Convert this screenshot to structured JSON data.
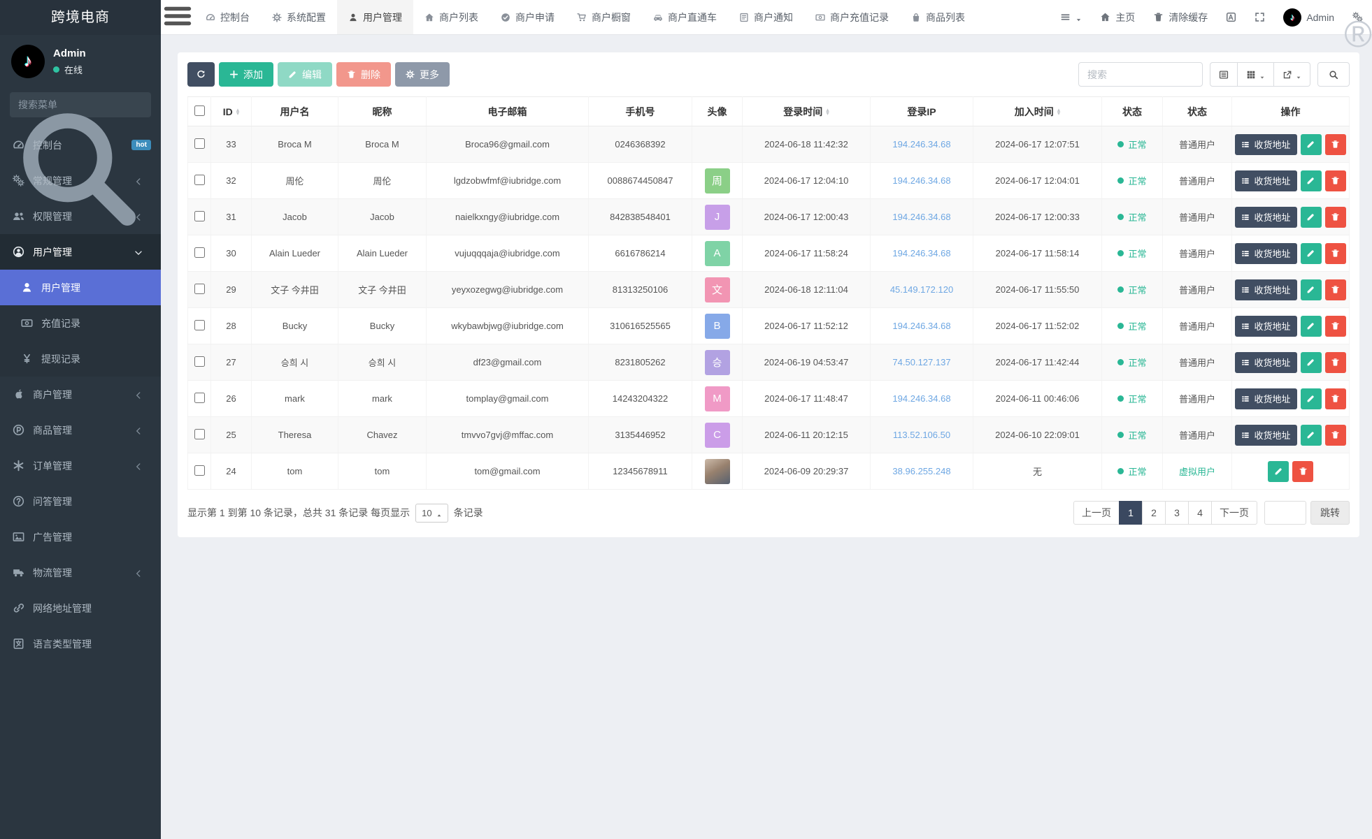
{
  "app": {
    "brand": "跨境电商",
    "user": "Admin",
    "status_label": "在线",
    "menu_search_placeholder": "搜索菜单",
    "watermark": "®"
  },
  "colors": {
    "sidebar_bg": "#2b3640",
    "active_menu_blue": "#5a6fd6",
    "accent_green": "#2ab795",
    "accent_red": "#ee5242",
    "dark_button": "#414e62",
    "link_blue": "#6ea7e3",
    "badge_hot_bg": "#3c8dbc"
  },
  "sidebar": {
    "items": [
      {
        "label": "控制台",
        "icon": "gauge",
        "badge": "hot"
      },
      {
        "label": "常规管理",
        "icon": "gears",
        "arrow": "left"
      },
      {
        "label": "权限管理",
        "icon": "users",
        "arrow": "left"
      },
      {
        "label": "用户管理",
        "icon": "user-circle",
        "arrow": "down",
        "open": true,
        "children": [
          {
            "label": "用户管理",
            "icon": "user",
            "active": true
          },
          {
            "label": "充值记录",
            "icon": "money"
          },
          {
            "label": "提现记录",
            "icon": "yen"
          }
        ]
      },
      {
        "label": "商户管理",
        "icon": "apple",
        "arrow": "left"
      },
      {
        "label": "商品管理",
        "icon": "product",
        "arrow": "left"
      },
      {
        "label": "订单管理",
        "icon": "asterisk",
        "arrow": "left"
      },
      {
        "label": "问答管理",
        "icon": "question"
      },
      {
        "label": "广告管理",
        "icon": "image"
      },
      {
        "label": "物流管理",
        "icon": "truck",
        "arrow": "left"
      },
      {
        "label": "网络地址管理",
        "icon": "link"
      },
      {
        "label": "语言类型管理",
        "icon": "language"
      }
    ]
  },
  "navbar": {
    "tabs": [
      {
        "label": "控制台",
        "icon": "gauge"
      },
      {
        "label": "系统配置",
        "icon": "gear"
      },
      {
        "label": "用户管理",
        "icon": "user",
        "active": true
      },
      {
        "label": "商户列表",
        "icon": "home"
      },
      {
        "label": "商户申请",
        "icon": "check-circle"
      },
      {
        "label": "商户橱窗",
        "icon": "cart"
      },
      {
        "label": "商户直通车",
        "icon": "car"
      },
      {
        "label": "商户通知",
        "icon": "notice"
      },
      {
        "label": "商户充值记录",
        "icon": "money"
      },
      {
        "label": "商品列表",
        "icon": "bag"
      }
    ],
    "home_label": "主页",
    "clear_cache_label": "清除缓存",
    "admin_label": "Admin"
  },
  "toolbar": {
    "add_label": "添加",
    "edit_label": "编辑",
    "delete_label": "删除",
    "more_label": "更多",
    "search_placeholder": "搜索"
  },
  "table": {
    "address_label": "收货地址",
    "columns": [
      {
        "label": "ID",
        "sortable": true
      },
      {
        "label": "用户名"
      },
      {
        "label": "昵称"
      },
      {
        "label": "电子邮箱"
      },
      {
        "label": "手机号"
      },
      {
        "label": "头像"
      },
      {
        "label": "登录时间",
        "sortable": true
      },
      {
        "label": "登录IP"
      },
      {
        "label": "加入时间",
        "sortable": true
      },
      {
        "label": "状态"
      },
      {
        "label": "状态"
      },
      {
        "label": "操作"
      }
    ],
    "status_normal": "正常",
    "rows": [
      {
        "id": "33",
        "username": "Broca M",
        "nickname": "Broca M",
        "email": "Broca96@gmail.com",
        "phone": "0246368392",
        "avatar": {
          "type": "none"
        },
        "login_time": "2024-06-18 11:42:32",
        "login_ip": "194.246.34.68",
        "join_time": "2024-06-17 12:07:51",
        "status": "正常",
        "user_type": "普通用户",
        "virtual": false,
        "has_address": true
      },
      {
        "id": "32",
        "username": "周伦",
        "nickname": "周伦",
        "email": "lgdzobwfmf@iubridge.com",
        "phone": "0088674450847",
        "avatar": {
          "type": "letter",
          "text": "周",
          "color": "#8bcf87"
        },
        "login_time": "2024-06-17 12:04:10",
        "login_ip": "194.246.34.68",
        "join_time": "2024-06-17 12:04:01",
        "status": "正常",
        "user_type": "普通用户",
        "virtual": false,
        "has_address": true
      },
      {
        "id": "31",
        "username": "Jacob",
        "nickname": "Jacob",
        "email": "naielkxngy@iubridge.com",
        "phone": "842838548401",
        "avatar": {
          "type": "letter",
          "text": "J",
          "color": "#c79fe8"
        },
        "login_time": "2024-06-17 12:00:43",
        "login_ip": "194.246.34.68",
        "join_time": "2024-06-17 12:00:33",
        "status": "正常",
        "user_type": "普通用户",
        "virtual": false,
        "has_address": true
      },
      {
        "id": "30",
        "username": "Alain Lueder",
        "nickname": "Alain Lueder",
        "email": "vujuqqqaja@iubridge.com",
        "phone": "6616786214",
        "avatar": {
          "type": "letter",
          "text": "A",
          "color": "#7fd3a6"
        },
        "login_time": "2024-06-17 11:58:24",
        "login_ip": "194.246.34.68",
        "join_time": "2024-06-17 11:58:14",
        "status": "正常",
        "user_type": "普通用户",
        "virtual": false,
        "has_address": true
      },
      {
        "id": "29",
        "username": "文子 今井田",
        "nickname": "文子 今井田",
        "email": "yeyxozegwg@iubridge.com",
        "phone": "81313250106",
        "avatar": {
          "type": "letter",
          "text": "文",
          "color": "#f295b3"
        },
        "login_time": "2024-06-18 12:11:04",
        "login_ip": "45.149.172.120",
        "join_time": "2024-06-17 11:55:50",
        "status": "正常",
        "user_type": "普通用户",
        "virtual": false,
        "has_address": true
      },
      {
        "id": "28",
        "username": "Bucky",
        "nickname": "Bucky",
        "email": "wkybawbjwg@iubridge.com",
        "phone": "310616525565",
        "avatar": {
          "type": "letter",
          "text": "B",
          "color": "#86a9e8"
        },
        "login_time": "2024-06-17 11:52:12",
        "login_ip": "194.246.34.68",
        "join_time": "2024-06-17 11:52:02",
        "status": "正常",
        "user_type": "普通用户",
        "virtual": false,
        "has_address": true
      },
      {
        "id": "27",
        "username": "승희 시",
        "nickname": "승희 시",
        "email": "df23@gmail.com",
        "phone": "8231805262",
        "avatar": {
          "type": "letter",
          "text": "승",
          "color": "#b2a2e2"
        },
        "login_time": "2024-06-19 04:53:47",
        "login_ip": "74.50.127.137",
        "join_time": "2024-06-17 11:42:44",
        "status": "正常",
        "user_type": "普通用户",
        "virtual": false,
        "has_address": true
      },
      {
        "id": "26",
        "username": "mark",
        "nickname": "mark",
        "email": "tomplay@gmail.com",
        "phone": "14243204322",
        "avatar": {
          "type": "letter",
          "text": "M",
          "color": "#f09ac6"
        },
        "login_time": "2024-06-17 11:48:47",
        "login_ip": "194.246.34.68",
        "join_time": "2024-06-11 00:46:06",
        "status": "正常",
        "user_type": "普通用户",
        "virtual": false,
        "has_address": true
      },
      {
        "id": "25",
        "username": "Theresa",
        "nickname": "Chavez",
        "email": "tmvvo7gvj@mffac.com",
        "phone": "3135446952",
        "avatar": {
          "type": "letter",
          "text": "C",
          "color": "#cb9de8"
        },
        "login_time": "2024-06-11 20:12:15",
        "login_ip": "113.52.106.50",
        "join_time": "2024-06-10 22:09:01",
        "status": "正常",
        "user_type": "普通用户",
        "virtual": false,
        "has_address": true
      },
      {
        "id": "24",
        "username": "tom",
        "nickname": "tom",
        "email": "tom@gmail.com",
        "phone": "12345678911",
        "avatar": {
          "type": "photo"
        },
        "login_time": "2024-06-09 20:29:37",
        "login_ip": "38.96.255.248",
        "join_time": "无",
        "status": "正常",
        "user_type": "虚拟用户",
        "virtual": true,
        "has_address": false
      }
    ]
  },
  "footer": {
    "summary_prefix": "显示第 1 到第 10 条记录，总共 31 条记录 每页显示",
    "page_size": "10",
    "summary_suffix": "条记录",
    "prev_label": "上一页",
    "next_label": "下一页",
    "pages": [
      "1",
      "2",
      "3",
      "4"
    ],
    "active_page": "1",
    "jump_label": "跳转"
  }
}
